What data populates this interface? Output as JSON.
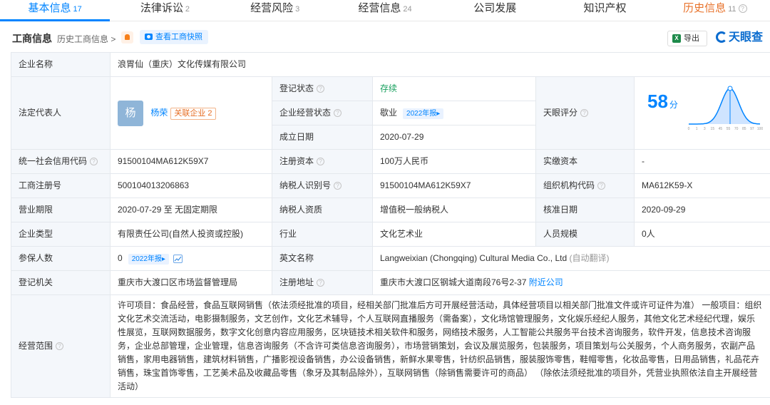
{
  "tabs": [
    {
      "label": "基本信息",
      "count": "17"
    },
    {
      "label": "法律诉讼",
      "count": "2"
    },
    {
      "label": "经营风险",
      "count": "3"
    },
    {
      "label": "经营信息",
      "count": "24"
    },
    {
      "label": "公司发展",
      "count": ""
    },
    {
      "label": "知识产权",
      "count": ""
    },
    {
      "label": "历史信息",
      "count": "11"
    }
  ],
  "header": {
    "title": "工商信息",
    "history": "历史工商信息 >",
    "snapshot": "查看工商快照",
    "export": "导出",
    "logo": "天眼查",
    "export_icon": "X"
  },
  "company": {
    "name_label": "企业名称",
    "name": "浪胃仙（重庆）文化传媒有限公司",
    "rep_label": "法定代表人",
    "rep_avatar": "杨",
    "rep_name": "杨荣",
    "rep_related": "关联企业 2",
    "status_label": "登记状态",
    "status": "存续",
    "op_status_label": "企业经营状态",
    "op_status": "歇业",
    "op_status_tag": "2022年报▸",
    "founded_label": "成立日期",
    "founded": "2020-07-29",
    "score_label": "天眼评分",
    "score": "58",
    "score_unit": "分",
    "credit_label": "统一社会信用代码",
    "credit": "91500104MA612K59X7",
    "capital_label": "注册资本",
    "capital": "100万人民币",
    "paid_label": "实缴资本",
    "paid": "-",
    "reg_no_label": "工商注册号",
    "reg_no": "500104013206863",
    "tax_id_label": "纳税人识别号",
    "tax_id": "91500104MA612K59X7",
    "org_code_label": "组织机构代码",
    "org_code": "MA612K59-X",
    "term_label": "营业期限",
    "term": "2020-07-29 至 无固定期限",
    "taxpayer_label": "纳税人资质",
    "taxpayer": "增值税一般纳税人",
    "approve_label": "核准日期",
    "approve": "2020-09-29",
    "type_label": "企业类型",
    "type": "有限责任公司(自然人投资或控股)",
    "industry_label": "行业",
    "industry": "文化艺术业",
    "staff_label": "人员规模",
    "staff": "0人",
    "insured_label": "参保人数",
    "insured": "0",
    "insured_tag": "2022年报▸",
    "en_label": "英文名称",
    "en_name": "Langweixian (Chongqing) Cultural Media Co., Ltd",
    "en_auto": "(自动翻译)",
    "authority_label": "登记机关",
    "authority": "重庆市大渡口区市场监督管理局",
    "address_label": "注册地址",
    "address": "重庆市大渡口区钢城大道南段76号2-37",
    "nearby": "附近公司",
    "scope_label": "经营范围",
    "scope": "许可项目：食品经营，食品互联网销售（依法须经批准的项目，经相关部门批准后方可开展经营活动，具体经营项目以相关部门批准文件或许可证件为准） 一般项目：组织文化艺术交流活动，电影摄制服务，文艺创作，文化艺术辅导，个人互联网直播服务（需备案），文化场馆管理服务，文化娱乐经纪人服务，其他文化艺术经纪代理，娱乐性展览，互联网数据服务，数字文化创意内容应用服务，区块链技术相关软件和服务，网络技术服务，人工智能公共服务平台技术咨询服务，软件开发，信息技术咨询服务，企业总部管理，企业管理，信息咨询服务（不含许可类信息咨询服务），市场营销策划，会议及展览服务，包装服务，项目策划与公关服务，个人商务服务，农副产品销售，家用电器销售，建筑材料销售，广播影视设备销售，办公设备销售，新鲜水果零售，针纺织品销售，服装服饰零售，鞋帽零售，化妆品零售，日用品销售，礼品花卉销售，珠宝首饰零售，工艺美术品及收藏品零售（象牙及其制品除外），互联网销售（除销售需要许可的商品） （除依法须经批准的项目外，凭营业执照依法自主开展经营活动）"
  },
  "score_chart": {
    "ticks": [
      "0",
      "1",
      "3",
      "15",
      "45",
      "55",
      "70",
      "85",
      "97",
      "100"
    ],
    "value": 58,
    "colors": {
      "curve": "#0084ff",
      "fill": "#cfe4ff"
    }
  }
}
